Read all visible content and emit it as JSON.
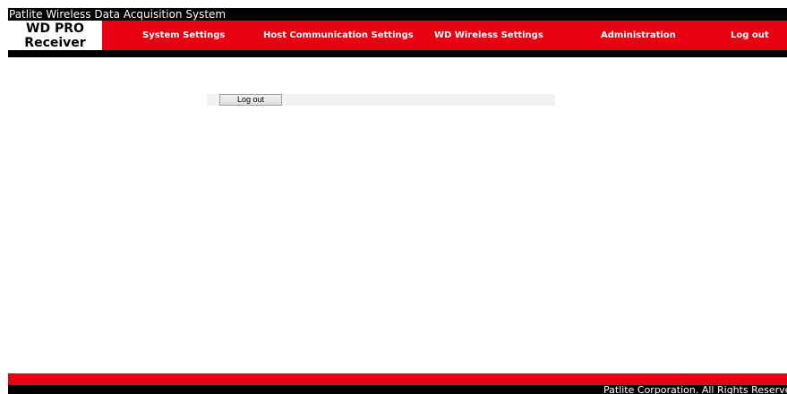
{
  "window": {
    "title": "Patlite Wireless Data Acquisition System"
  },
  "header": {
    "product_line1": "WD PRO",
    "product_line2": "Receiver",
    "nav": [
      {
        "label": "System Settings"
      },
      {
        "label": "Host Communication Settings"
      },
      {
        "label": "WD Wireless Settings"
      },
      {
        "label": "Administration"
      },
      {
        "label": "Log out"
      }
    ]
  },
  "main": {
    "logout_button_label": "Log out"
  },
  "footer": {
    "copyright": "Patlite Corporation. All Rights Reserved."
  },
  "colors": {
    "brand_red": "#e60012",
    "bar_black": "#000000"
  }
}
